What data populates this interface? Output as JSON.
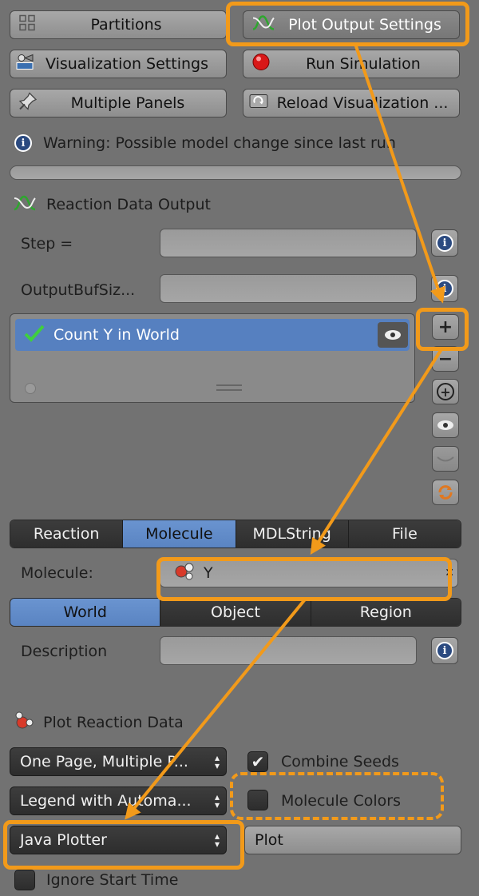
{
  "toolbar": {
    "partitions": "Partitions",
    "plot_output_settings": "Plot Output Settings",
    "visualization_settings": "Visualization Settings",
    "run_simulation": "Run Simulation",
    "multiple_panels": "Multiple Panels",
    "reload_visualization": "Reload Visualization ..."
  },
  "warning": "Warning: Possible model change since last run",
  "section": {
    "reaction_data_output": "Reaction Data Output",
    "plot_reaction_data": "Plot Reaction Data"
  },
  "fields": {
    "step_label": "Step =",
    "step_value": "",
    "output_buf_label": "OutputBufSiz...",
    "output_buf_value": "",
    "molecule_label": "Molecule:",
    "molecule_value": "Y",
    "description_label": "Description",
    "description_value": ""
  },
  "list": {
    "items": [
      {
        "label": "Count Y in World"
      }
    ]
  },
  "tabs_type": [
    "Reaction",
    "Molecule",
    "MDLString",
    "File"
  ],
  "tabs_location": [
    "World",
    "Object",
    "Region"
  ],
  "plot": {
    "layout_option": "One Page, Multiple P...",
    "legend_option": "Legend with Automa...",
    "plotter_option": "Java Plotter",
    "combine_seeds": "Combine Seeds",
    "molecule_colors": "Molecule Colors",
    "plot_button": "Plot",
    "ignore_start_time": "Ignore Start Time"
  },
  "colors": {
    "panel_bg": "#727272",
    "accent_blue": "#5a84c2",
    "annotation_orange": "#f29a1a"
  }
}
